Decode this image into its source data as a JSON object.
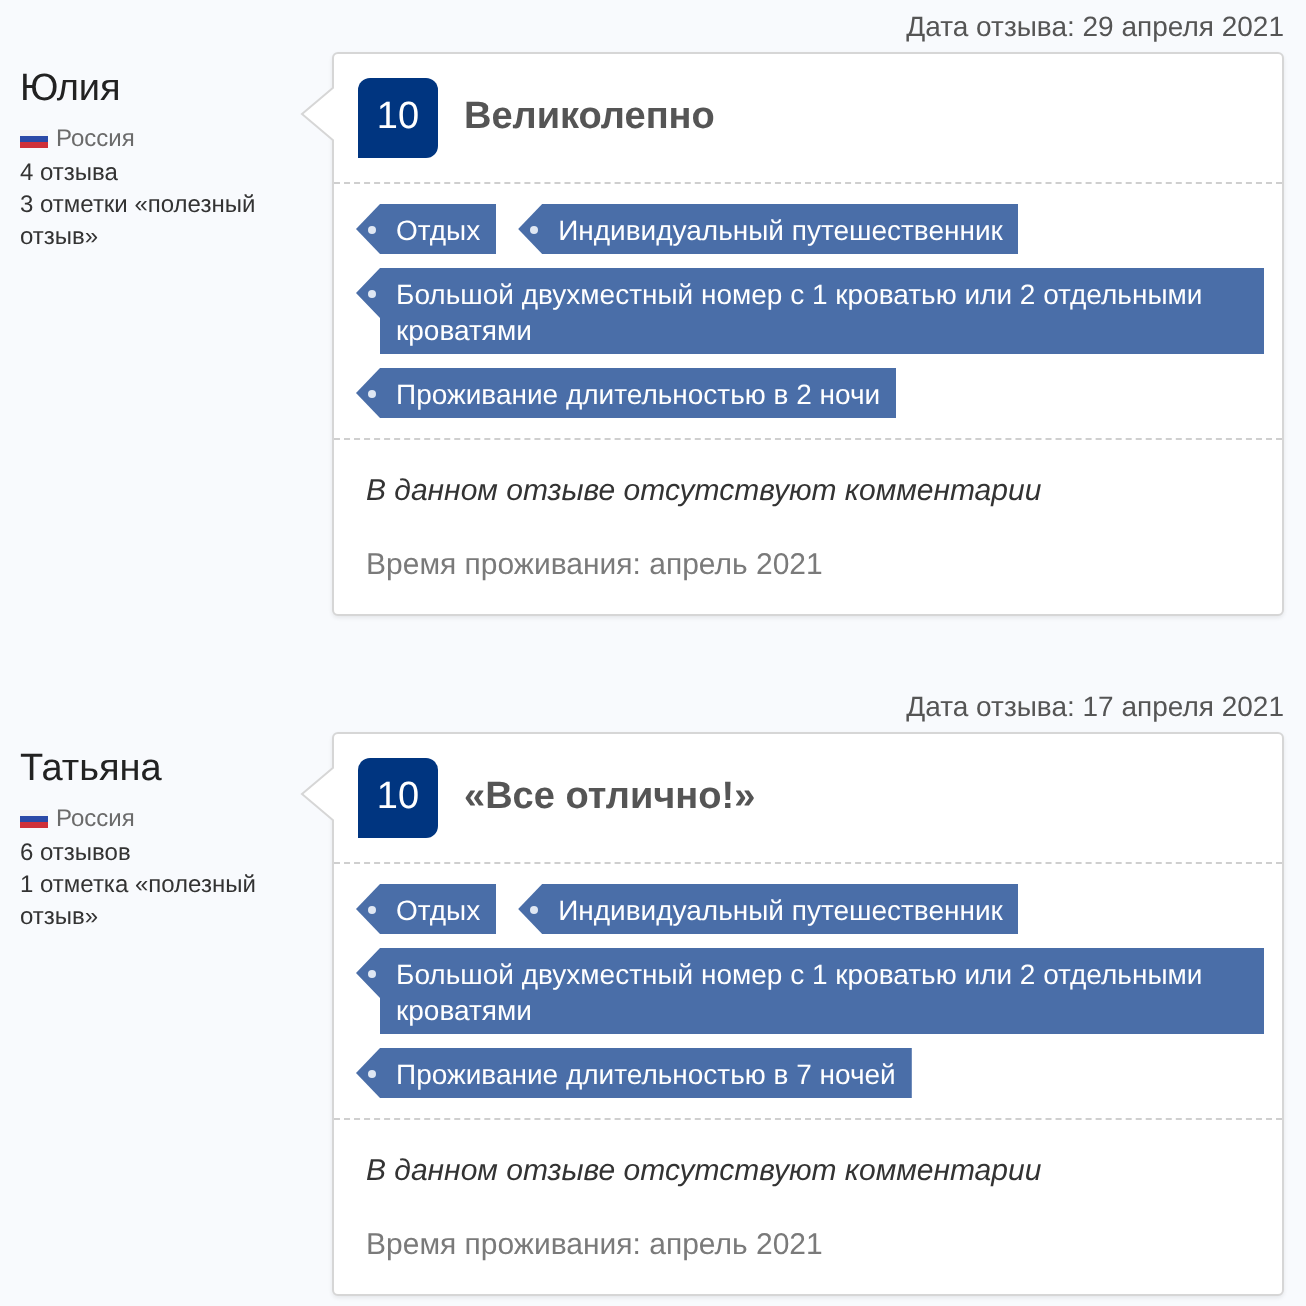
{
  "reviews": [
    {
      "date": "Дата отзыва: 29 апреля 2021",
      "reviewer": {
        "name": "Юлия",
        "country": "Россия",
        "review_count": "4 отзыва",
        "helpful_votes": "3 отметки «полезный отзыв»"
      },
      "score": "10",
      "title": "Великолепно",
      "tags": [
        "Отдых",
        "Индивидуальный путешественник",
        "Большой двухместный номер с 1 кроватью или 2 отдельными кроватями",
        "Проживание длительностью в 2 ночи"
      ],
      "comment": "В данном отзыве отсутствуют комментарии",
      "stay_period": "Время проживания: апрель 2021"
    },
    {
      "date": "Дата отзыва: 17 апреля 2021",
      "reviewer": {
        "name": "Татьяна",
        "country": "Россия",
        "review_count": "6 отзывов",
        "helpful_votes": "1 отметка «полезный отзыв»"
      },
      "score": "10",
      "title": "«Все отлично!»",
      "tags": [
        "Отдых",
        "Индивидуальный путешественник",
        "Большой двухместный номер с 1 кроватью или 2 отдельными кроватями",
        "Проживание длительностью в 7 ночей"
      ],
      "comment": "В данном отзыве отсутствуют комментарии",
      "stay_period": "Время проживания: апрель 2021"
    }
  ]
}
